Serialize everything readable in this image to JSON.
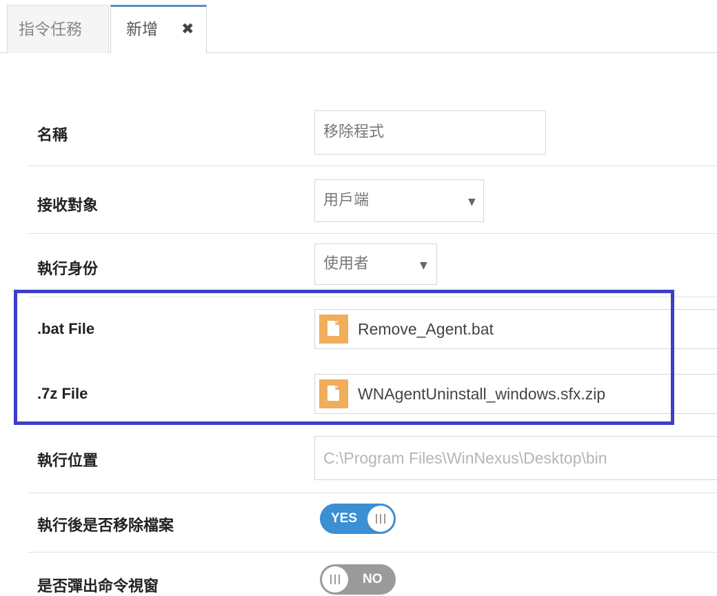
{
  "tabs": [
    {
      "label": "指令任務",
      "active": false
    },
    {
      "label": "新增",
      "active": true,
      "close_icon": "close-x-icon"
    }
  ],
  "form": {
    "name": {
      "label": "名稱",
      "value": "移除程式"
    },
    "receiver": {
      "label": "接收對象",
      "value": "用戶端"
    },
    "run_as": {
      "label": "執行身份",
      "value": "使用者"
    },
    "bat_file": {
      "label": ".bat File",
      "filename": "Remove_Agent.bat",
      "icon": "file-icon"
    },
    "sevenz_file": {
      "label": ".7z File",
      "filename": "WNAgentUninstall_windows.sfx.zip",
      "icon": "file-icon"
    },
    "run_location": {
      "label": "執行位置",
      "placeholder": "C:\\Program Files\\WinNexus\\Desktop\\bin"
    },
    "delete_after_run": {
      "label": "執行後是否移除檔案",
      "state": "YES"
    },
    "popup_cmd_window": {
      "label": "是否彈出命令視窗",
      "state": "NO"
    }
  },
  "colors": {
    "highlight_border": "#3b3fc8",
    "toggle_on": "#3b8fd3",
    "toggle_off": "#9a9a9a",
    "file_icon": "#f0ad5a",
    "active_tab_top": "#5b8cbf"
  }
}
